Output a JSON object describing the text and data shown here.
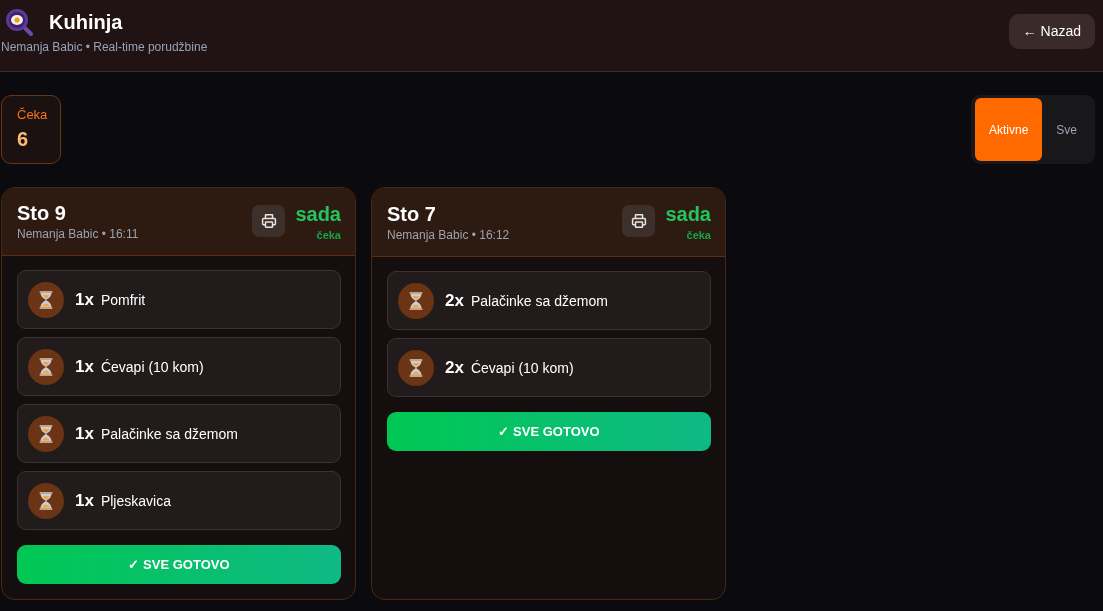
{
  "header": {
    "title": "Kuhinja",
    "subtitle": "Nemanja Babic • Real-time porudžbine",
    "back_button": "← Nazad"
  },
  "stats": [
    {
      "label": "Čeka",
      "value": "6"
    }
  ],
  "filter_tabs": [
    {
      "label": "Aktivne",
      "selected": true
    },
    {
      "label": "Sve",
      "selected": false
    }
  ],
  "orders": [
    {
      "table": "Sto 9",
      "meta": "Nemanja Babic • 16:11",
      "time": "sada",
      "status": "čeka",
      "items": [
        {
          "qty": "1x",
          "name": "Pomfrit"
        },
        {
          "qty": "1x",
          "name": "Ćevapi (10 kom)"
        },
        {
          "qty": "1x",
          "name": "Palačinke sa džemom"
        },
        {
          "qty": "1x",
          "name": "Pljeskavica"
        }
      ],
      "done_button": "✓ SVE GOTOVO"
    },
    {
      "table": "Sto 7",
      "meta": "Nemanja Babic • 16:12",
      "time": "sada",
      "status": "čeka",
      "items": [
        {
          "qty": "2x",
          "name": "Palačinke sa džemom"
        },
        {
          "qty": "2x",
          "name": "Ćevapi (10 kom)"
        }
      ],
      "done_button": "✓ SVE GOTOVO"
    }
  ]
}
